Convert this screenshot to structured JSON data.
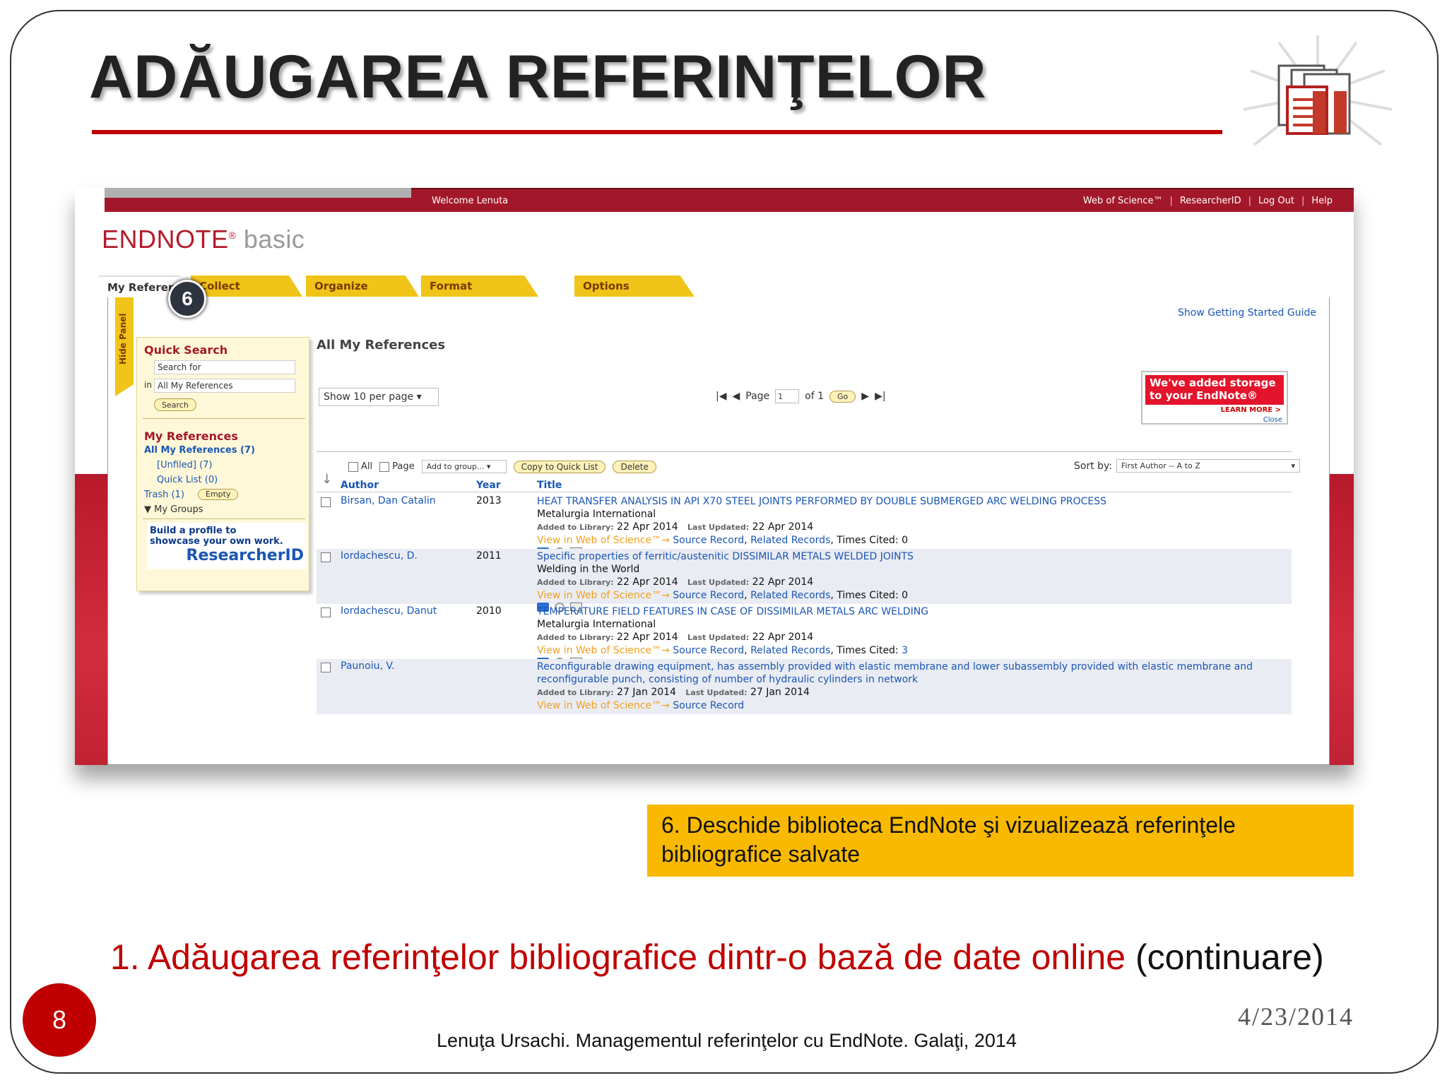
{
  "slide": {
    "title": "ADĂUGAREA REFERINŢELOR",
    "callout": "6. Deschide biblioteca EndNote şi vizualizează referinţele bibliografice salvate",
    "subtitle_red": "1. Adăugarea referinţelor bibliografice dintr-o bază de date online",
    "subtitle_black": " (continuare)",
    "slide_number": "8",
    "date": "4/23/2014",
    "footer": "Lenuţa Ursachi. Managementul referinţelor cu EndNote. Galaţi, 2014",
    "step_badge": "6",
    "colors": {
      "accent_red": "#c00000",
      "callout_yellow": "#f8b900"
    }
  },
  "endnote": {
    "welcome": "Welcome Lenuta",
    "top_links": [
      "Web of Science™",
      "ResearcherID",
      "Log Out",
      "Help"
    ],
    "brand_main": "ENDNOTE",
    "brand_sub": "basic",
    "tabs": [
      "My Referen",
      "Collect",
      "Organize",
      "Format",
      "Options"
    ],
    "hide_panel": "Hide Panel",
    "getting_started": "Show Getting Started Guide",
    "quick_search": {
      "heading": "Quick Search",
      "search_placeholder": "Search for",
      "in_label": "in",
      "scope": "All My References",
      "button": "Search"
    },
    "my_refs": {
      "heading": "My References",
      "all": "All My References (7)",
      "unfiled": "[Unfiled] (7)",
      "quick_list": "Quick List (0)",
      "trash": "Trash (1)",
      "empty_btn": "Empty",
      "groups": "▼ My Groups"
    },
    "researcher_promo": {
      "line1": "Build a profile to",
      "line2": "showcase your own work.",
      "brand": "ResearcherID"
    },
    "main_title": "All My References",
    "per_page": "Show 10 per page",
    "pager": {
      "page_label": "Page",
      "page_value": "1",
      "of_label": "of 1",
      "go": "Go"
    },
    "promo": {
      "text": "We've added storage to your EndNote®",
      "learn_more": "LEARN MORE >",
      "close": "Close"
    },
    "toolbar": {
      "all": "All",
      "page": "Page",
      "add_to_group": "Add to group...",
      "copy": "Copy to Quick List",
      "delete": "Delete"
    },
    "sort": {
      "label": "Sort by:",
      "value": "First Author -- A to Z"
    },
    "columns": {
      "author": "Author",
      "year": "Year",
      "title": "Title"
    },
    "labels": {
      "added": "Added to Library:",
      "updated": "Last Updated:",
      "wos": "View in Web of Science™→",
      "source": "Source Record",
      "related": "Related Records",
      "cited": "Times Cited:"
    },
    "rows": [
      {
        "author": "Birsan, Dan Catalin",
        "year": "2013",
        "title": "HEAT TRANSFER ANALYSIS IN API X70 STEEL JOINTS PERFORMED BY DOUBLE SUBMERGED ARC WELDING PROCESS",
        "journal": "Metalurgia International",
        "added": "22 Apr 2014",
        "updated": "22 Apr 2014",
        "cited": "0"
      },
      {
        "author": "Iordachescu, D.",
        "year": "2011",
        "title": "Specific properties of ferritic/austenitic DISSIMILAR METALS WELDED JOINTS",
        "journal": "Welding in the World",
        "added": "22 Apr 2014",
        "updated": "22 Apr 2014",
        "cited": "0"
      },
      {
        "author": "Iordachescu, Danut",
        "year": "2010",
        "title": "TEMPERATURE FIELD FEATURES IN CASE OF DISSIMILAR METALS ARC WELDING",
        "journal": "Metalurgia International",
        "added": "22 Apr 2014",
        "updated": "22 Apr 2014",
        "cited": "3"
      },
      {
        "author": "Paunoiu, V.",
        "year": "",
        "title": "Reconfigurable drawing equipment, has assembly provided with elastic membrane and lower subassembly provided with elastic membrane and reconfigurable punch, consisting of number of hydraulic cylinders in network",
        "journal": "",
        "added": "27 Jan 2014",
        "updated": "27 Jan 2014",
        "cited": ""
      }
    ]
  }
}
